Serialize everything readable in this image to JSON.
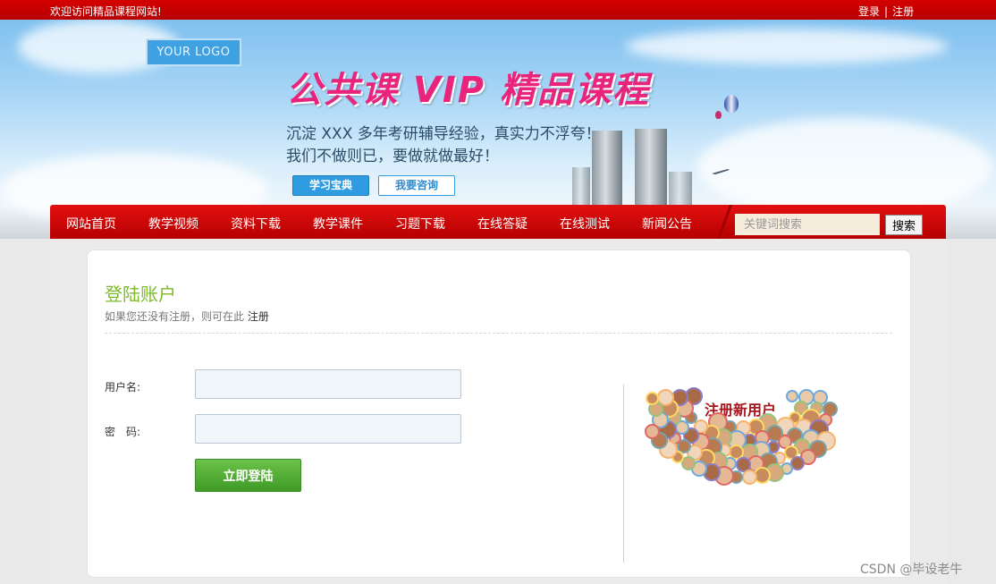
{
  "topbar": {
    "welcome": "欢迎访问精品课程网站!",
    "login": "登录",
    "separator": "|",
    "register": "注册"
  },
  "banner": {
    "logo": "YOUR LOGO",
    "title": "公共课 VIP 精品课程",
    "slogan_line1": "沉淀 XXX 多年考研辅导经验，真实力不浮夸！",
    "slogan_line2": "我们不做则已，要做就做最好！",
    "button_study": "学习宝典",
    "button_consult": "我要咨询"
  },
  "nav": {
    "items": [
      "网站首页",
      "教学视频",
      "资料下载",
      "教学课件",
      "习题下载",
      "在线答疑",
      "在线测试",
      "新闻公告"
    ],
    "search_placeholder": "关键词搜索",
    "search_button": "搜索"
  },
  "login": {
    "title": "登陆账户",
    "subtitle_prefix": "如果您还没有注册，则可在此",
    "subtitle_link": "注册",
    "username_label": "用户名:",
    "password_label": "密　码:",
    "username_value": "",
    "password_value": "",
    "submit": "立即登陆"
  },
  "promo": {
    "title": "注册新用户"
  },
  "watermark": "CSDN @毕设老牛",
  "colors": {
    "brand_red": "#c80000",
    "accent_green": "#7dba2a",
    "button_green": "#4aa72f",
    "title_pink": "#e8247c"
  }
}
